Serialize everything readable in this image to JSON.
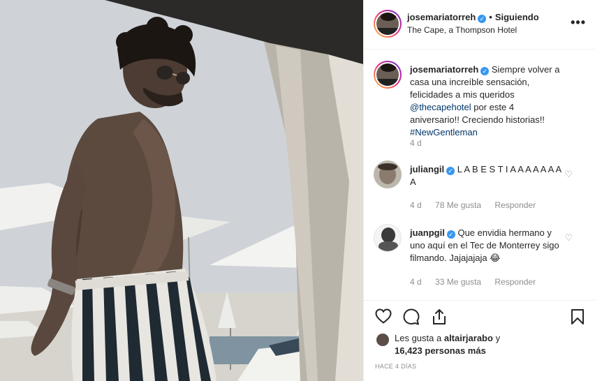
{
  "header": {
    "username": "josemariatorreh",
    "separator": "•",
    "follow_status": "Siguiendo",
    "location": "The Cape, a Thompson Hotel",
    "more_icon": "more-horizontal-icon"
  },
  "caption": {
    "username": "josemariatorreh",
    "text_before": "Siempre volver a casa una increíble sensación, felicidades a mis queridos",
    "mention": "@thecapehotel",
    "text_middle": "por este 4 aniversario!! Creciendo historias!!",
    "hashtag": "#NewGentleman",
    "time": "4 d"
  },
  "comments": [
    {
      "username": "juliangil",
      "text": "L A B E S T I A A A A A A A A",
      "time": "4 d",
      "likes": "78 Me gusta",
      "reply": "Responder"
    },
    {
      "username": "juanpgil",
      "text": "Que envidia hermano y uno aquí en el Tec de Monterrey sigo filmando. Jajajajaja",
      "emoji": "😂",
      "time": "4 d",
      "likes": "33 Me gusta",
      "reply": "Responder"
    }
  ],
  "actions": {
    "like_icon": "heart-icon",
    "comment_icon": "comment-icon",
    "share_icon": "share-icon",
    "save_icon": "bookmark-icon"
  },
  "likes": {
    "prefix": "Les gusta a",
    "first_user": "altairjarabo",
    "connector": "y",
    "count": "16,423 personas más"
  },
  "posted": "HACE 4 DÍAS",
  "colors": {
    "verified": "#3897f0",
    "mention": "#003569",
    "muted": "#8e8e8e",
    "text": "#262626"
  }
}
